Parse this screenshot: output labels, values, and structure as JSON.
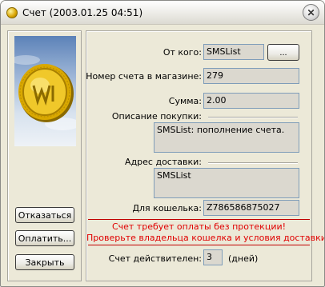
{
  "window": {
    "title": "Счет (2003.01.25 04:51)",
    "close_symbol": "✕"
  },
  "left": {
    "image_icon": "gold-coin-icon",
    "buttons": {
      "refuse": "Отказаться",
      "pay": "Оплатить...",
      "close": "Закрыть"
    }
  },
  "form": {
    "from_label": "От кого:",
    "from_value": "SMSList",
    "from_button": "...",
    "order_label": "Номер счета в магазине:",
    "order_value": "279",
    "sum_label": "Сумма:",
    "sum_value": "2.00",
    "description_label": "Описание покупки:",
    "description_value": "SMSList: пополнение счета.",
    "address_label": "Адрес доставки:",
    "address_value": "SMSList",
    "wallet_label": "Для кошелька:",
    "wallet_value": "Z786586875027",
    "warning_line1": "Счет требует оплаты без протекции!",
    "warning_line2": "Проверьте владельца кошелка и условия доставки!",
    "valid_label": "Счет действителен:",
    "valid_value": "3",
    "valid_unit": "(дней)"
  },
  "colors": {
    "window_bg": "#ece9d8",
    "field_bg": "#dbd8cf",
    "warning": "#e00000"
  }
}
